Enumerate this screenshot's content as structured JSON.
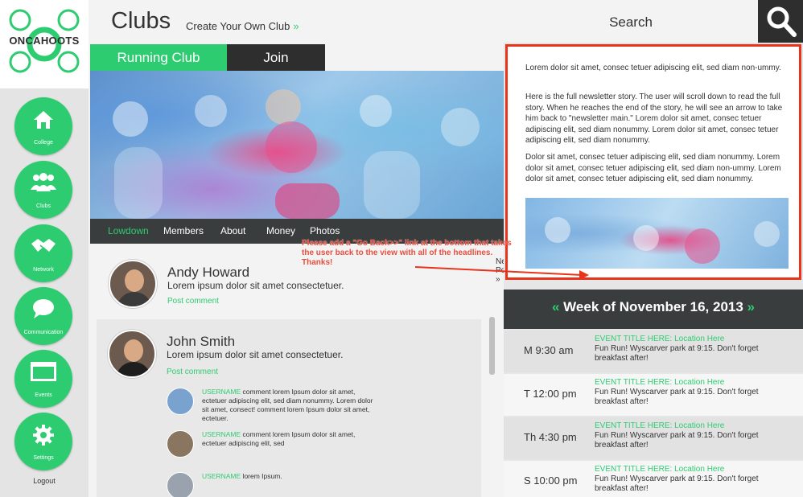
{
  "app": {
    "logo_text": "ONCAHOOTS"
  },
  "sidebar": {
    "items": [
      {
        "label": "College",
        "icon": "home-icon"
      },
      {
        "label": "Clubs",
        "icon": "group-icon"
      },
      {
        "label": "Network",
        "icon": "handshake-icon"
      },
      {
        "label": "Communication",
        "icon": "speech-bubble-icon"
      },
      {
        "label": "Events",
        "icon": "calendar-icon"
      },
      {
        "label": "Settings",
        "icon": "gear-icon"
      }
    ],
    "logout_label": "Logout"
  },
  "header": {
    "title": "Clubs",
    "subtitle": "Create Your Own Club",
    "subtitle_chevron": "»"
  },
  "club": {
    "name": "Running Club",
    "join_label": "Join"
  },
  "tabs": [
    {
      "label": "Lowdown",
      "active": true
    },
    {
      "label": "Members",
      "active": false
    },
    {
      "label": "About",
      "active": false
    },
    {
      "label": "Money",
      "active": false
    },
    {
      "label": "Photos",
      "active": false
    }
  ],
  "annotation": "Please add a \"Go Back>>\" link at the bottom that takes the user back to the view with all of the headlines. Thanks!",
  "new_post_label": "New Post »",
  "posts": [
    {
      "author": "Andy Howard",
      "text": "Lorem ipsum dolor sit amet consectetuer.",
      "post_comment_label": "Post comment"
    },
    {
      "author": "John Smith",
      "text": "Lorem ipsum dolor sit amet consectetuer.",
      "post_comment_label": "Post comment",
      "comments": [
        {
          "username": "USERNAME",
          "text": " comment lorem Ipsum dolor sit amet, ectetuer adipiscing elit, sed diam nonummy. Lorem dolor sit amet, consect! comment lorem Ipsum dolor sit amet, ectetuer."
        },
        {
          "username": "USERNAME",
          "text": " comment lorem Ipsum dolor sit amet, ectetuer adipiscing elit, sed"
        },
        {
          "username": "USERNAME",
          "text": " lorem Ipsum."
        }
      ]
    }
  ],
  "search": {
    "label": "Search"
  },
  "newsletter": {
    "paragraphs": [
      "Lorem dolor sit amet, consec tetuer adipiscing elit, sed diam non-ummy.",
      "Here is the full newsletter story. The user will scroll down to read the full story. When he reaches the end of the story, he will see an arrow to take him back to \"newsletter main.\" Lorem dolor sit amet, consec tetuer adipiscing elit, sed diam nonummy. Lorem dolor sit amet, consec tetuer adipiscing elit, sed diam nonummy.",
      "Dolor sit amet, consec tetuer adipiscing elit, sed diam nonummy. Lorem dolor sit amet, consec tetuer adipiscing elit, sed diam non-ummy. Lorem dolor sit amet, consec tetuer adipiscing elit, sed diam nonummy."
    ]
  },
  "calendar": {
    "prev": "«",
    "next": "»",
    "week_label": "Week of November 16, 2013",
    "events": [
      {
        "time": "M 9:30 am",
        "title": "EVENT TITLE HERE: Location Here",
        "desc": "Fun Run! Wyscarver park at 9:15. Don't forget breakfast after!"
      },
      {
        "time": "T 12:00 pm",
        "title": "EVENT TITLE HERE: Location Here",
        "desc": "Fun Run! Wyscarver park at 9:15. Don't forget breakfast after!"
      },
      {
        "time": "Th 4:30 pm",
        "title": "EVENT TITLE HERE: Location Here",
        "desc": "Fun Run! Wyscarver park at 9:15. Don't forget breakfast after!"
      },
      {
        "time": "S 10:00 pm",
        "title": "EVENT TITLE HERE: Location Here",
        "desc": "Fun Run! Wyscarver park at 9:15. Don't forget breakfast after!"
      }
    ]
  },
  "colors": {
    "accent": "#2ecc71",
    "dark": "#2e2e2e",
    "annotation": "#e74c3c",
    "highlight_border": "#e8341c"
  }
}
